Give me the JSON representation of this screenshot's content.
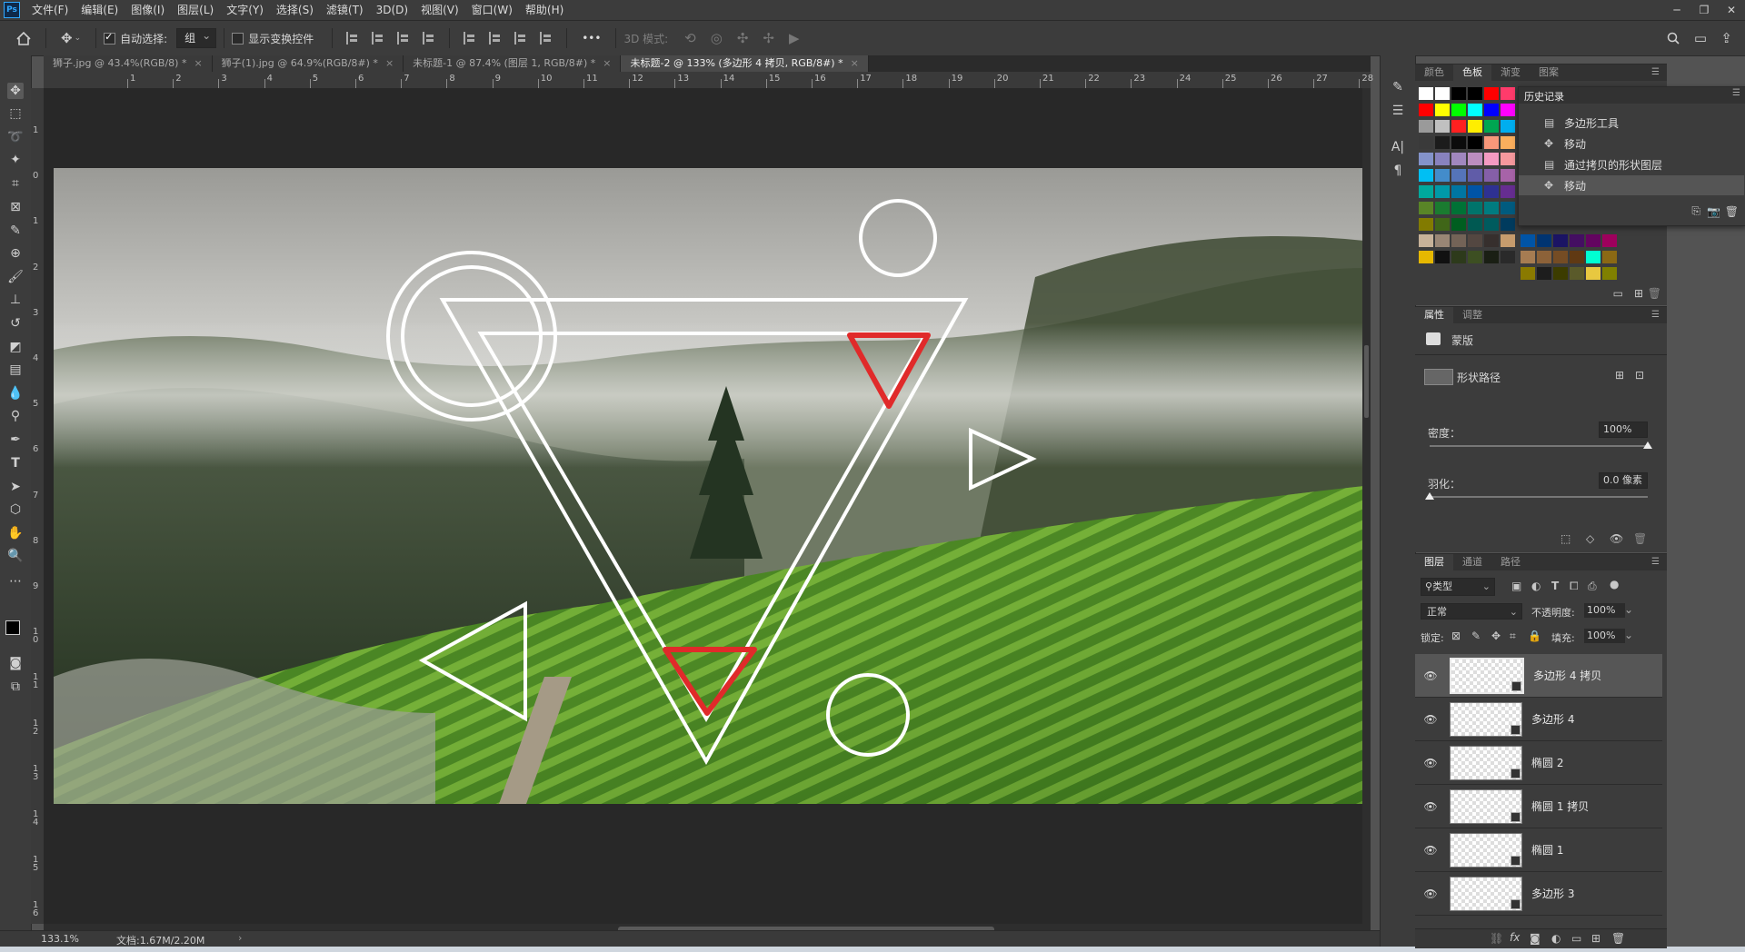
{
  "app": {
    "logo": "Ps"
  },
  "menu": [
    "文件(F)",
    "编辑(E)",
    "图像(I)",
    "图层(L)",
    "文字(Y)",
    "选择(S)",
    "滤镜(T)",
    "3D(D)",
    "视图(V)",
    "窗口(W)",
    "帮助(H)"
  ],
  "window_controls": {
    "minimize": "─",
    "restore": "❐",
    "close": "✕"
  },
  "options": {
    "auto_select_label": "自动选择:",
    "auto_select_value": "组",
    "show_transform_label": "显示变换控件",
    "mode_3d_label": "3D 模式:",
    "more": "•••"
  },
  "tabs": [
    {
      "label": "狮子.jpg @ 43.4%(RGB/8) *",
      "active": false
    },
    {
      "label": "狮子(1).jpg @ 64.9%(RGB/8#) *",
      "active": false
    },
    {
      "label": "未标题-1 @ 87.4% (图层 1, RGB/8#) *",
      "active": false
    },
    {
      "label": "未标题-2 @ 133% (多边形 4 拷贝, RGB/8#) *",
      "active": true
    }
  ],
  "tab_close": "×",
  "ruler_top": [
    "1",
    "2",
    "3",
    "4",
    "5",
    "6",
    "7",
    "8",
    "9",
    "10",
    "11",
    "12",
    "13",
    "14",
    "15",
    "16",
    "17",
    "18",
    "19",
    "20",
    "21",
    "22",
    "23",
    "24",
    "25",
    "26",
    "27",
    "28"
  ],
  "ruler_left": [
    "1",
    "0",
    "1",
    "2",
    "3",
    "4",
    "5",
    "6",
    "7",
    "8",
    "9",
    "1 0",
    "1 1",
    "1 2",
    "1 3",
    "1 4",
    "1 5",
    "1 6"
  ],
  "status": {
    "zoom": "133.1%",
    "doc": "文档:1.67M/2.20M"
  },
  "color_panel": {
    "tabs": [
      "颜色",
      "色板",
      "渐变",
      "图案"
    ],
    "active_tab": "色板",
    "colors": {
      "row1": [
        "#ffffff",
        "#ffffff",
        "#000000",
        "#000000",
        "#ff0000",
        "#ff3b6b"
      ],
      "row2": [
        "#ff0000",
        "#ffff00",
        "#00ff00",
        "#00ffff",
        "#0000ff",
        "#ff00ff"
      ],
      "row3": [
        "#9a9a9a",
        "#c0c0c0",
        "#ff2020",
        "#ffee00",
        "#00a651",
        "#00aeef"
      ],
      "row4": [
        "#3a3a3a",
        "#1c1c1c",
        "#0b0b0b",
        "#000000",
        "#f7977a",
        "#fbaf5d"
      ],
      "row5": [
        "#8493ca",
        "#8882be",
        "#a187be",
        "#bc8dbf",
        "#f49ac2",
        "#f6989d"
      ],
      "row6": [
        "#00bff3",
        "#438ccb",
        "#5574b9",
        "#605ca8",
        "#855fa8",
        "#a763a8"
      ],
      "row7": [
        "#00a99d",
        "#0099a8",
        "#0076a3",
        "#0054a6",
        "#2e3192",
        "#662d91"
      ],
      "row8": [
        "#598527",
        "#1a7b30",
        "#007236",
        "#00746b",
        "#007c80",
        "#005b7f"
      ],
      "row9": [
        "#827b00",
        "#406618",
        "#005e20",
        "#005952",
        "#005b5e",
        "#003b5e"
      ],
      "row10": [
        "#c7b299",
        "#998675",
        "#736357",
        "#534741",
        "#362f2d",
        "#c69c6d"
      ],
      "row11": [
        "#e6b800",
        "#111111",
        "#2d3a1b",
        "#3d4f22",
        "#1a1f14",
        "#2a2a2a"
      ],
      "extra_a": [
        "#0054a6",
        "#003471",
        "#1b1464",
        "#440e62",
        "#630460",
        "#9e005d"
      ],
      "extra_b": [
        "#a67c52",
        "#8c6239",
        "#754c24",
        "#603913",
        "#00ffd2",
        "#8b6914"
      ],
      "extra_c": [
        "#8a7a00",
        "#1d1d1d",
        "#3c3c00",
        "#5a5a2a",
        "#e8c840",
        "#808000"
      ]
    }
  },
  "history_panel": {
    "title": "历史记录",
    "items": [
      {
        "label": "多边形工具",
        "selected": false
      },
      {
        "label": "移动",
        "selected": false
      },
      {
        "label": "通过拷贝的形状图层",
        "selected": false
      },
      {
        "label": "移动",
        "selected": true
      }
    ]
  },
  "properties_panel": {
    "tabs": [
      "属性",
      "调整"
    ],
    "active_tab": "属性",
    "mask_label": "蒙版",
    "vector_label": "形状路径",
    "density_label": "密度：",
    "density_value": "100%",
    "density_level": 1.0,
    "feather_label": "羽化：",
    "feather_value": "0.0 像素",
    "feather_level": 0.0
  },
  "layers_panel": {
    "tabs": [
      "图层",
      "通道",
      "路径"
    ],
    "active_tab": "图层",
    "filter_label": "类型",
    "blend_mode": "正常",
    "opacity_label": "不透明度:",
    "opacity_value": "100%",
    "lock_label": "锁定:",
    "fill_label": "填充:",
    "fill_value": "100%",
    "layers": [
      {
        "name": "多边形 4 拷贝",
        "selected": true
      },
      {
        "name": "多边形 4",
        "selected": false
      },
      {
        "name": "椭圆 2",
        "selected": false
      },
      {
        "name": "椭圆 1 拷贝",
        "selected": false
      },
      {
        "name": "椭圆 1",
        "selected": false
      },
      {
        "name": "多边形 3",
        "selected": false
      }
    ]
  },
  "accent": {
    "shape_white": "#ffffff",
    "shape_red": "#e02a2a"
  }
}
